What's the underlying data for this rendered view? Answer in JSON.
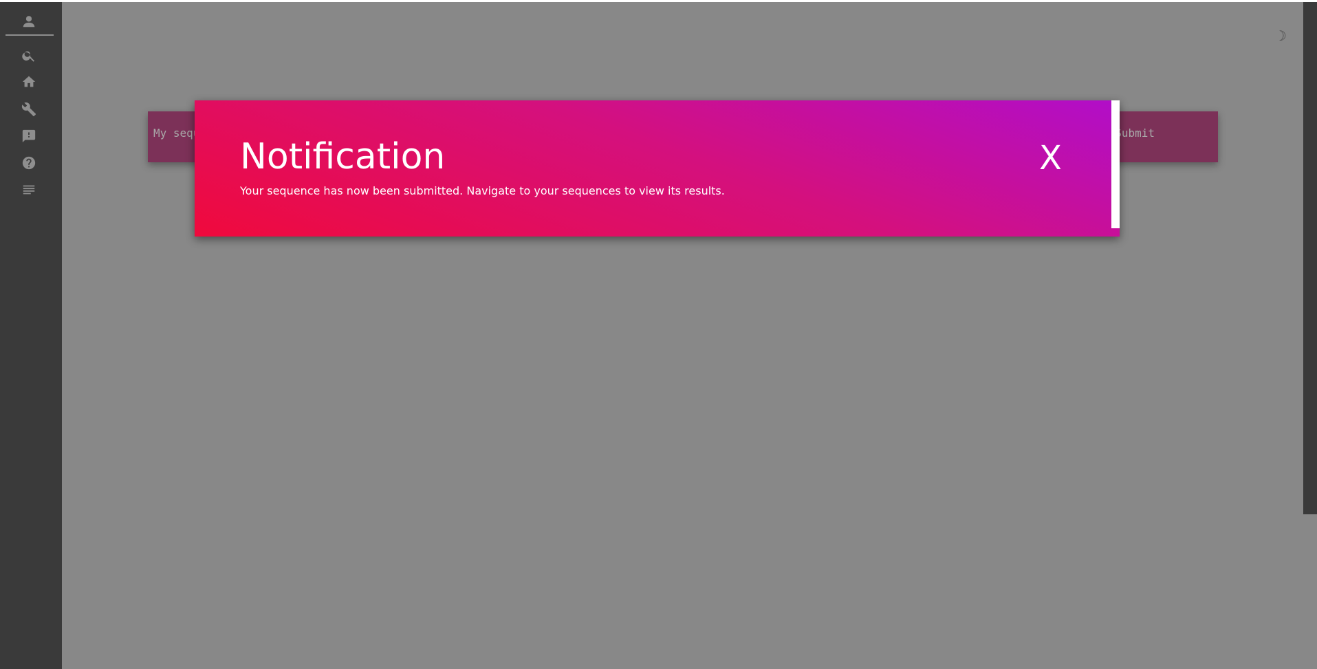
{
  "sidebar": {
    "icons": [
      {
        "name": "user-icon"
      },
      {
        "name": "search-icon"
      },
      {
        "name": "home-icon"
      },
      {
        "name": "wrench-icon"
      },
      {
        "name": "feedback-icon"
      },
      {
        "name": "help-icon"
      },
      {
        "name": "list-icon"
      }
    ]
  },
  "header": {
    "theme_toggle_glyph": "☽"
  },
  "sequence_form": {
    "input_placeholder": "My sequence",
    "submit_label": "Submit"
  },
  "notification": {
    "title": "Notification",
    "message": "Your sequence has now been submitted. Navigate to your sequences to view its results.",
    "close_label": "X"
  },
  "colors": {
    "sidebar_bg": "#3a3a3a",
    "overlay_bg": "#888888",
    "modal_gradient_start": "#f00a3c",
    "modal_gradient_end": "#b10ec9"
  }
}
